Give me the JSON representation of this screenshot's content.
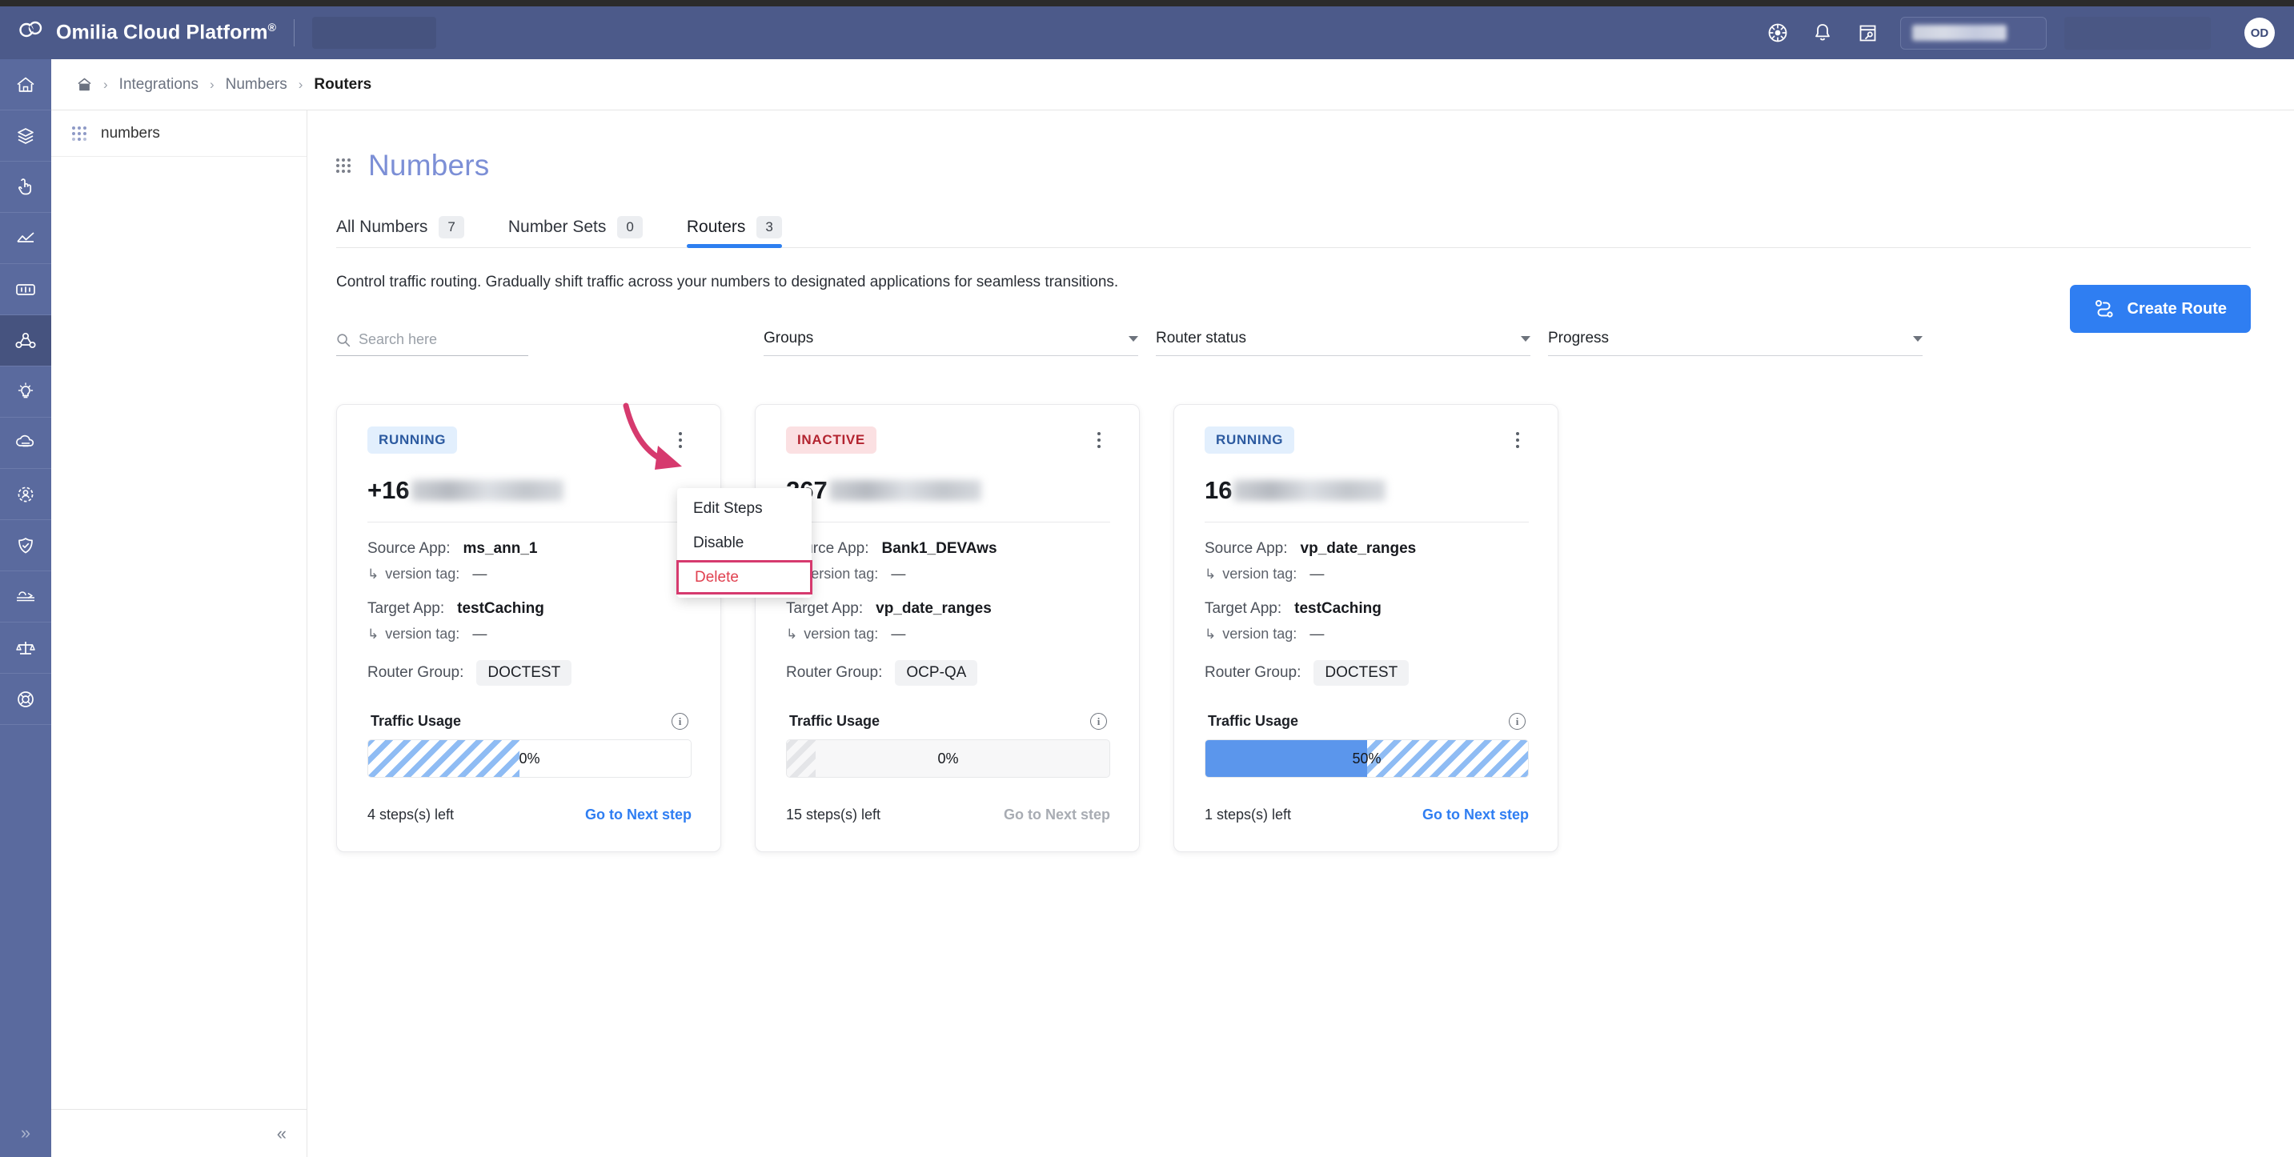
{
  "header": {
    "brand": "Omilia Cloud Platform",
    "brand_mark": "®",
    "icons": [
      "settings-wheel-icon",
      "bell-icon",
      "note-key-icon"
    ],
    "avatar_initials": "OD"
  },
  "rail": {
    "items": [
      {
        "name": "home-icon"
      },
      {
        "name": "layers-icon"
      },
      {
        "name": "hand-click-icon"
      },
      {
        "name": "analytics-icon"
      },
      {
        "name": "dialog-icon"
      },
      {
        "name": "integrations-icon"
      },
      {
        "name": "lightbulb-icon"
      },
      {
        "name": "cloud-icon"
      },
      {
        "name": "people-gear-icon"
      },
      {
        "name": "shield-check-icon"
      },
      {
        "name": "tools-icon"
      },
      {
        "name": "scales-icon"
      },
      {
        "name": "lifebuoy-icon"
      }
    ],
    "expand_glyph": "»"
  },
  "breadcrumb": {
    "home_icon": "home-icon",
    "separator": "›",
    "items": [
      "Integrations",
      "Numbers",
      "Routers"
    ]
  },
  "panel": {
    "item_label": "numbers",
    "collapse_glyph": "«"
  },
  "main": {
    "page_title": "Numbers",
    "subtitle": "Control traffic routing. Gradually shift traffic across your numbers to designated applications for seamless transitions.",
    "tabs": [
      {
        "label": "All Numbers",
        "count": "7",
        "active": false
      },
      {
        "label": "Number Sets",
        "count": "0",
        "active": false
      },
      {
        "label": "Routers",
        "count": "3",
        "active": true
      }
    ],
    "create_button": "Create Route"
  },
  "filters": {
    "search_placeholder": "Search here",
    "selects": [
      {
        "label": "Groups"
      },
      {
        "label": "Router status"
      },
      {
        "label": "Progress"
      }
    ]
  },
  "labels": {
    "source_app": "Source App:",
    "target_app": "Target App:",
    "version_tag": "version tag:",
    "router_group": "Router Group:",
    "traffic_usage": "Traffic Usage",
    "next_step": "Go to Next step",
    "arrow_glyph": "↳",
    "info_glyph": "i"
  },
  "cards": [
    {
      "status": "RUNNING",
      "status_kind": "running",
      "number_prefix": "+16",
      "source_app": "ms_ann_1",
      "source_version_tag": "—",
      "target_app": "testCaching",
      "target_version_tag": "—",
      "router_group": "DOCTEST",
      "usage_pct": "0%",
      "usage_value": 0,
      "stripe_color": "blue",
      "bar_muted": false,
      "steps_left": "4 steps(s) left",
      "next_disabled": false
    },
    {
      "status": "INACTIVE",
      "status_kind": "inactive",
      "number_prefix": "267",
      "source_app": "Bank1_DEVAws",
      "source_version_tag": "—",
      "target_app": "vp_date_ranges",
      "target_version_tag": "—",
      "router_group": "OCP-QA",
      "usage_pct": "0%",
      "usage_value": 0,
      "stripe_color": "gray",
      "bar_muted": true,
      "steps_left": "15 steps(s) left",
      "next_disabled": true
    },
    {
      "status": "RUNNING",
      "status_kind": "running",
      "number_prefix": "16",
      "source_app": "vp_date_ranges",
      "source_version_tag": "—",
      "target_app": "testCaching",
      "target_version_tag": "—",
      "router_group": "DOCTEST",
      "usage_pct": "50%",
      "usage_value": 50,
      "stripe_color": "blue",
      "bar_muted": false,
      "steps_left": "1 steps(s) left",
      "next_disabled": false
    }
  ],
  "context_menu": {
    "items": [
      {
        "label": "Edit Steps",
        "danger": false,
        "highlighted": false
      },
      {
        "label": "Disable",
        "danger": false,
        "highlighted": false
      },
      {
        "label": "Delete",
        "danger": true,
        "highlighted": true
      }
    ]
  },
  "colors": {
    "accent_blue": "#2f7ef2",
    "header_bg": "#4c5a8a",
    "rail_bg": "#5a6a9e",
    "running_bg": "#e2effd",
    "running_fg": "#2c5aa0",
    "inactive_bg": "#fbe0e2",
    "inactive_fg": "#b32430",
    "annotation_pink": "#d63a6e",
    "bar_fill": "#5b96ec",
    "title_color": "#7c8fd6"
  }
}
